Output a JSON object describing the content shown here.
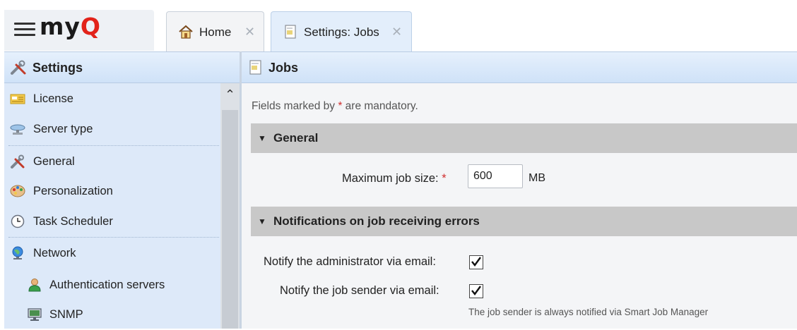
{
  "app": {
    "logo_text_main": "my",
    "logo_text_q": "Q"
  },
  "tabs": [
    {
      "label": "Home",
      "close": "✕"
    },
    {
      "label": "Settings: Jobs",
      "close": "✕"
    }
  ],
  "sidebar": {
    "title": "Settings",
    "scroll_up": "⌃",
    "items": [
      {
        "label": "License",
        "icon": "license-icon"
      },
      {
        "label": "Server type",
        "icon": "server-type-icon"
      },
      {
        "label": "General",
        "icon": "tools-icon"
      },
      {
        "label": "Personalization",
        "icon": "palette-icon"
      },
      {
        "label": "Task Scheduler",
        "icon": "clock-icon"
      },
      {
        "label": "Network",
        "icon": "globe-icon"
      },
      {
        "label": "Authentication servers",
        "icon": "user-icon"
      },
      {
        "label": "SNMP",
        "icon": "monitor-icon"
      }
    ]
  },
  "content": {
    "title": "Jobs",
    "mandatory_prefix": "Fields marked by ",
    "mandatory_star": "*",
    "mandatory_suffix": " are mandatory.",
    "sections": [
      {
        "title": "General",
        "caret": "▼"
      },
      {
        "title": "Notifications on job receiving errors",
        "caret": "▼"
      }
    ],
    "max_job_size": {
      "label": "Maximum job size:",
      "required_mark": "*",
      "value": "600",
      "unit": "MB"
    },
    "notify_admin": {
      "label": "Notify the administrator via email:",
      "checked": true
    },
    "notify_sender": {
      "label": "Notify the job sender via email:",
      "checked": true
    },
    "hint": "The job sender is always notified via Smart Job Manager"
  },
  "colors": {
    "accent": "#e2231a",
    "header_bg": "#d8e7fa",
    "section_bg": "#c8c8c8",
    "required": "#d03030"
  }
}
